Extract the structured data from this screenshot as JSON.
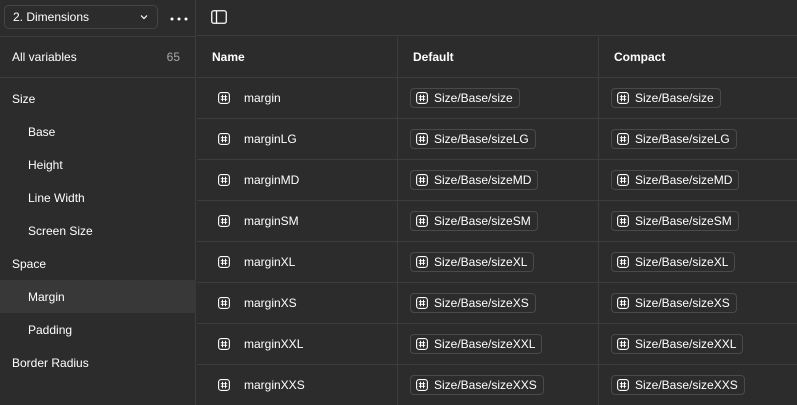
{
  "sidebar": {
    "collection": "2. Dimensions",
    "all_variables_label": "All variables",
    "all_variables_count": "65",
    "groups": [
      {
        "label": "Size",
        "child": false,
        "selected": false
      },
      {
        "label": "Base",
        "child": true,
        "selected": false
      },
      {
        "label": "Height",
        "child": true,
        "selected": false
      },
      {
        "label": "Line Width",
        "child": true,
        "selected": false
      },
      {
        "label": "Screen Size",
        "child": true,
        "selected": false
      },
      {
        "label": "Space",
        "child": false,
        "selected": false
      },
      {
        "label": "Margin",
        "child": true,
        "selected": true
      },
      {
        "label": "Padding",
        "child": true,
        "selected": false
      },
      {
        "label": "Border Radius",
        "child": false,
        "selected": false
      }
    ]
  },
  "table": {
    "headers": {
      "name": "Name",
      "default": "Default",
      "compact": "Compact"
    },
    "rows": [
      {
        "name": "margin",
        "default": "Size/Base/size",
        "compact": "Size/Base/size"
      },
      {
        "name": "marginLG",
        "default": "Size/Base/sizeLG",
        "compact": "Size/Base/sizeLG"
      },
      {
        "name": "marginMD",
        "default": "Size/Base/sizeMD",
        "compact": "Size/Base/sizeMD"
      },
      {
        "name": "marginSM",
        "default": "Size/Base/sizeSM",
        "compact": "Size/Base/sizeSM"
      },
      {
        "name": "marginXL",
        "default": "Size/Base/sizeXL",
        "compact": "Size/Base/sizeXL"
      },
      {
        "name": "marginXS",
        "default": "Size/Base/sizeXS",
        "compact": "Size/Base/sizeXS"
      },
      {
        "name": "marginXXL",
        "default": "Size/Base/sizeXXL",
        "compact": "Size/Base/sizeXXL"
      },
      {
        "name": "marginXXS",
        "default": "Size/Base/sizeXXS",
        "compact": "Size/Base/sizeXXS"
      }
    ]
  },
  "icons": {
    "collection_dropdown": "chevron-down-icon",
    "more": "more-horizontal-icon",
    "sidebar_toggle": "sidebar-panel-icon",
    "variable_type": "number-hash-icon",
    "alias_type": "number-hash-icon"
  },
  "colors": {
    "background": "#2c2c2c",
    "border": "#3d3d3d",
    "selected_row": "#383838",
    "text": "#ffffff",
    "muted_text": "#a8a8a8"
  }
}
